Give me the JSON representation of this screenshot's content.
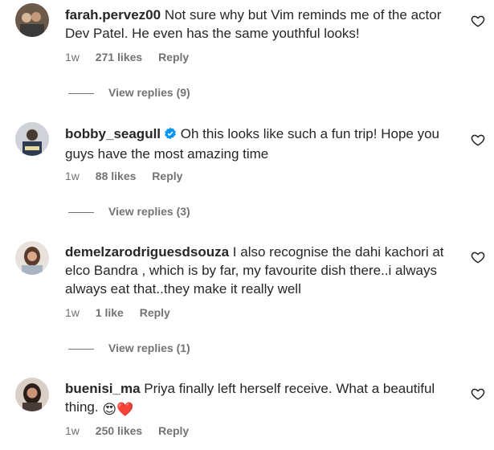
{
  "comments": [
    {
      "username": "farah.pervez00",
      "text": "Not sure why but Vim reminds me of the actor Dev Patel. He even has the same youthful looks!",
      "time": "1w",
      "likes": "271 likes",
      "reply": "Reply",
      "view_replies": "View replies (9)"
    },
    {
      "username": "bobby_seagull",
      "verified": true,
      "text": "Oh this looks like such a fun trip! Hope you guys have the most amazing time",
      "time": "1w",
      "likes": "88 likes",
      "reply": "Reply",
      "view_replies": "View replies (3)"
    },
    {
      "username": "demelzarodriguesdsouza",
      "text": "I also recognise the dahi kachori at elco Bandra , which is by far, my favourite dish there..i always always eat that..they make it really well",
      "time": "1w",
      "likes": "1 like",
      "reply": "Reply",
      "view_replies": "View replies (1)"
    },
    {
      "username": "buenisi_ma",
      "text": "Priya finally left herself receive. What a beautiful thing.",
      "emojis": "😍❤️",
      "time": "1w",
      "likes": "250 likes",
      "reply": "Reply"
    }
  ],
  "colors": {
    "text": "#262626",
    "secondary": "#737373",
    "verified": "#0095f6",
    "heart_red": "#ed4956"
  }
}
